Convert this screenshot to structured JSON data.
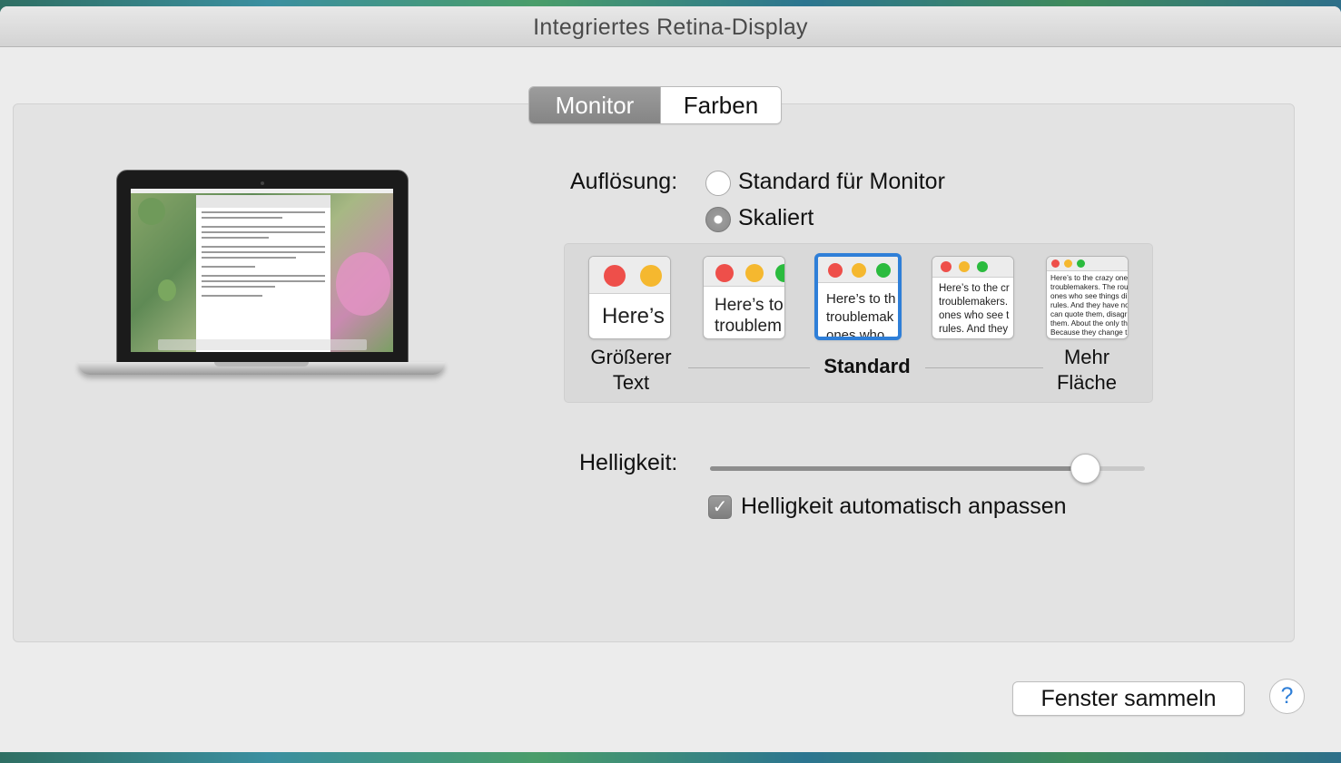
{
  "window": {
    "title": "Integriertes Retina-Display"
  },
  "tabs": [
    {
      "label": "Monitor",
      "active": true
    },
    {
      "label": "Farben",
      "active": false
    }
  ],
  "resolution": {
    "label": "Auflösung:",
    "options": [
      {
        "label": "Standard für Monitor",
        "selected": false
      },
      {
        "label": "Skaliert",
        "selected": true
      }
    ]
  },
  "scaling": {
    "thumbs": [
      {
        "text": "Here’s"
      },
      {
        "text": "Here’s to\ntroublem"
      },
      {
        "text": "Here’s to th\ntroublemak\nones who"
      },
      {
        "text": "Here’s to the cr\ntroublemakers.\nones who see t\nrules. And they"
      },
      {
        "text": "Here’s to the crazy one\ntroublemakers. The rou\nones who see things di\nrules. And they have no\ncan quote them, disagr\nthem. About the only th\nBecause they change t"
      }
    ],
    "selected_index": 2,
    "caption_left": "Größerer\nText",
    "caption_center": "Standard",
    "caption_right": "Mehr\nFläche"
  },
  "brightness": {
    "label": "Helligkeit:",
    "value": 0.86,
    "auto_label": "Helligkeit automatisch anpassen",
    "auto_checked": true,
    "check_glyph": "✓"
  },
  "footer": {
    "gather_button": "Fenster sammeln",
    "help_button": "?"
  },
  "colors": {
    "accent": "#2f7fd8",
    "dot_red": "#ee4f4a",
    "dot_yellow": "#f5b82f",
    "dot_green": "#2bbb3e"
  }
}
